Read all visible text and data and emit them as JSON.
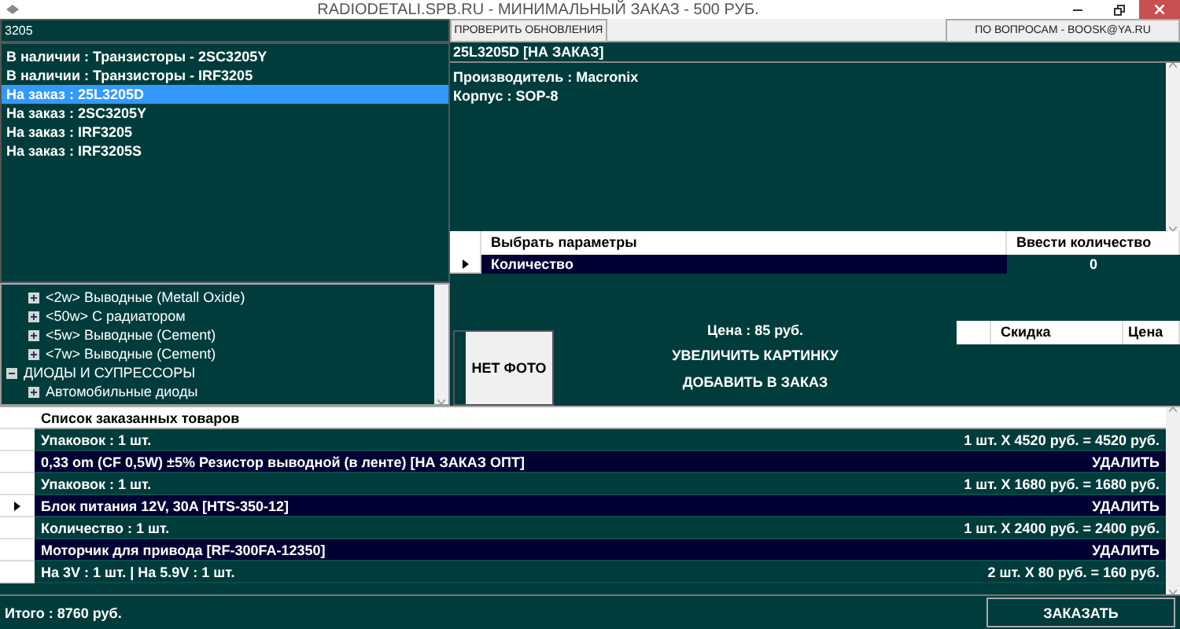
{
  "window": {
    "title": "RADIODETALI.SPB.RU - МИНИМАЛЬНЫЙ ЗАКАЗ - 500 РУБ."
  },
  "toolbar": {
    "search": {
      "value": "3205"
    },
    "update_button": "ПРОВЕРИТЬ ОБНОВЛЕНИЯ",
    "contact_button": "ПО ВОПРОСАМ - BOOSK@YA.RU"
  },
  "results": [
    {
      "label": "В наличии : Транзисторы - 2SC3205Y",
      "selected": false
    },
    {
      "label": "В наличии : Транзисторы - IRF3205",
      "selected": false
    },
    {
      "label": "На заказ : 25L3205D",
      "selected": true
    },
    {
      "label": "На заказ : 2SC3205Y",
      "selected": false
    },
    {
      "label": "На заказ : IRF3205",
      "selected": false
    },
    {
      "label": "На заказ : IRF3205S",
      "selected": false
    }
  ],
  "tree": {
    "continued_children": [
      {
        "label": "<2w> Выводные (Metall Oxide)",
        "expanded": false
      },
      {
        "label": "<50w> С радиатором",
        "expanded": false
      },
      {
        "label": "<5w> Выводные (Cement)",
        "expanded": false
      },
      {
        "label": "<7w> Выводные (Cement)",
        "expanded": false
      }
    ],
    "items": [
      {
        "label": "ДИОДЫ И СУПРЕССОРЫ",
        "expanded": true,
        "children": [
          {
            "label": "Автомобильные диоды",
            "expanded": false
          }
        ]
      }
    ]
  },
  "product": {
    "title": "25L3205D [НА ЗАКАЗ]",
    "details": [
      "Производитель : Macronix",
      "Корпус : SOP-8"
    ],
    "params": {
      "columns": [
        "Выбрать параметры",
        "Ввести количество"
      ],
      "rows": [
        {
          "name": "Количество",
          "quantity": "0",
          "current": true
        }
      ]
    },
    "photo": "НЕТ ФОТО",
    "price": "Цена : 85 руб.",
    "zoom_button": "УВЕЛИЧИТЬ КАРТИНКУ",
    "add_button": "ДОБАВИТЬ В ЗАКАЗ",
    "discounts": {
      "columns": [
        "Скидка",
        "Цена"
      ]
    }
  },
  "order": {
    "title": "Список заказанных товаров",
    "rows": [
      {
        "kind": "qty",
        "text": "Упаковок : 1 шт.",
        "amount": "1 шт. X 4520 руб. =  4520 руб.",
        "current": false
      },
      {
        "kind": "name",
        "text": "0,33 om (CF 0,5W) ±5% Резистор выводной (в ленте) [НА ЗАКАЗ ОПТ]",
        "action": "УДАЛИТЬ",
        "current": false
      },
      {
        "kind": "qty",
        "text": "Упаковок : 1 шт.",
        "amount": "1 шт. X 1680 руб. =  1680 руб.",
        "current": false
      },
      {
        "kind": "name",
        "text": "Блок питания 12V, 30A [HTS-350-12]",
        "action": "УДАЛИТЬ",
        "current": true
      },
      {
        "kind": "qty",
        "text": "Количество : 1 шт.",
        "amount": "1 шт. X 2400 руб. =  2400 руб.",
        "current": false
      },
      {
        "kind": "name",
        "text": "Моторчик для привода [RF-300FA-12350]",
        "action": "УДАЛИТЬ",
        "current": false
      },
      {
        "kind": "qty",
        "text": "На 3V : 1 шт. | На 5.9V : 1 шт.",
        "amount": "2 шт. X 80 руб. =  160 руб.",
        "current": false
      }
    ]
  },
  "footer": {
    "total": "Итого : 8760 руб.",
    "order_button": "ЗАКАЗАТЬ"
  }
}
